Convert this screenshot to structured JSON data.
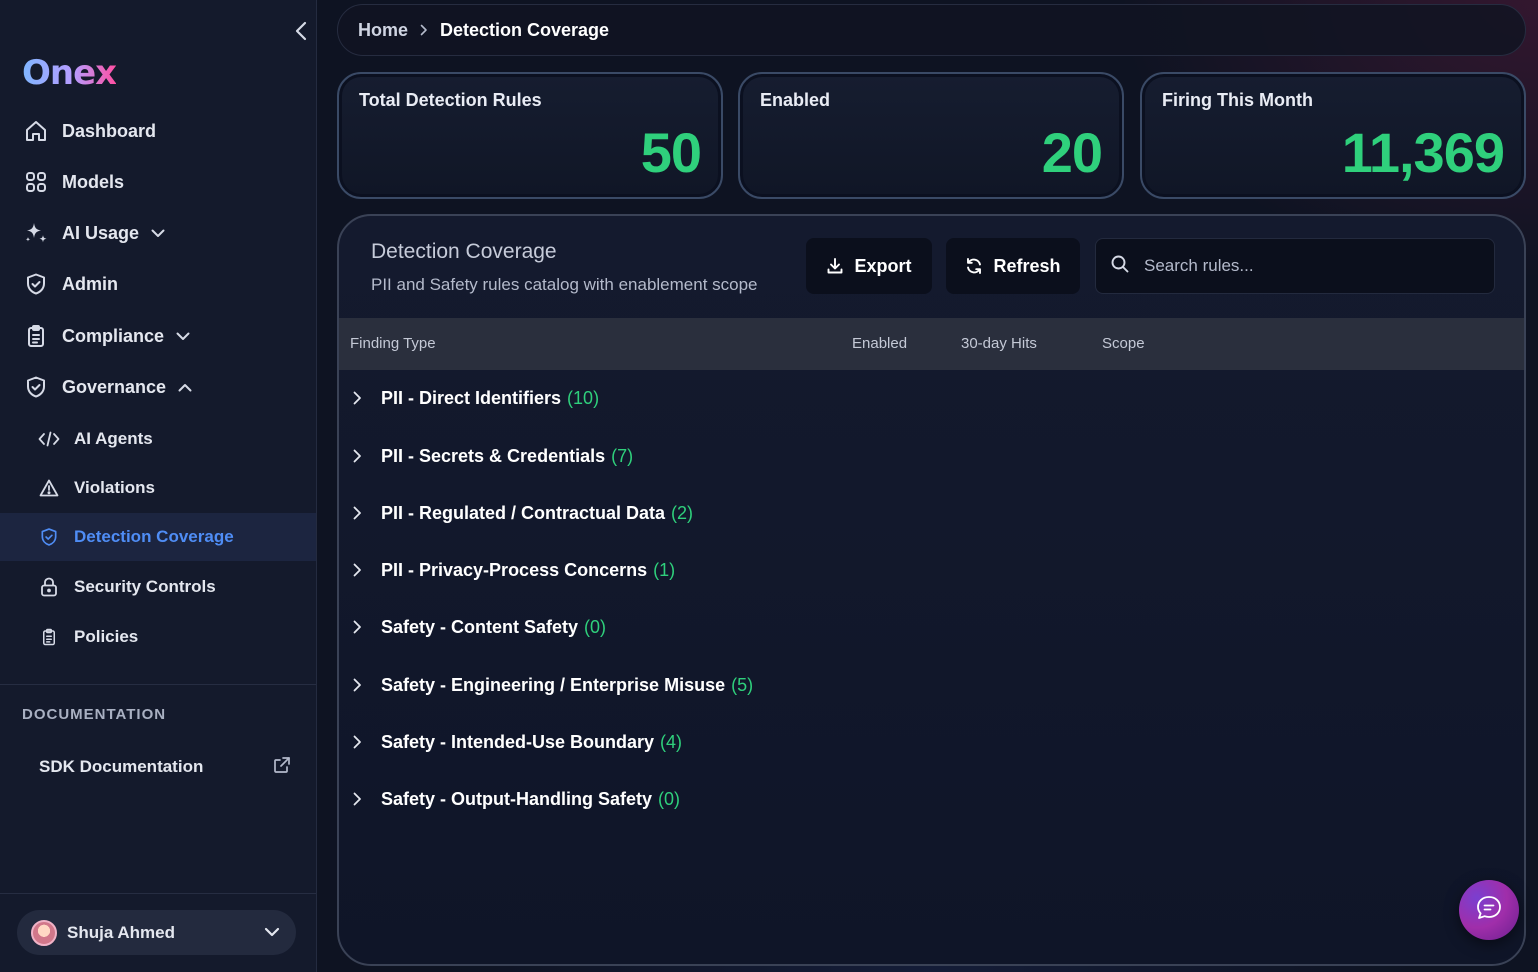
{
  "brand": {
    "logo_text": "Onex"
  },
  "sidebar": {
    "nav": [
      {
        "label": "Dashboard",
        "icon": "home-icon"
      },
      {
        "label": "Models",
        "icon": "grid-icon"
      },
      {
        "label": "AI Usage",
        "icon": "sparkles-icon",
        "expanded": false
      },
      {
        "label": "Admin",
        "icon": "shield-icon"
      },
      {
        "label": "Compliance",
        "icon": "clipboard-icon",
        "expanded": false
      },
      {
        "label": "Governance",
        "icon": "shield-check-icon",
        "expanded": true
      }
    ],
    "governance_items": [
      {
        "label": "AI Agents",
        "icon": "code-icon"
      },
      {
        "label": "Violations",
        "icon": "warning-icon"
      },
      {
        "label": "Detection Coverage",
        "icon": "shield-check-icon",
        "active": true
      },
      {
        "label": "Security Controls",
        "icon": "lock-icon"
      },
      {
        "label": "Policies",
        "icon": "clipboard-icon"
      }
    ],
    "documentation_header": "DOCUMENTATION",
    "sdk_link": "SDK Documentation",
    "user_name": "Shuja Ahmed"
  },
  "breadcrumb": {
    "home": "Home",
    "current": "Detection Coverage"
  },
  "stats": [
    {
      "label": "Total Detection Rules",
      "value": "50"
    },
    {
      "label": "Enabled",
      "value": "20"
    },
    {
      "label": "Firing This Month",
      "value": "11,369"
    }
  ],
  "panel": {
    "title": "Detection Coverage",
    "subtitle": "PII and Safety rules catalog with enablement scope",
    "export_label": "Export",
    "refresh_label": "Refresh",
    "search_placeholder": "Search rules..."
  },
  "table": {
    "columns": [
      "Finding Type",
      "Enabled",
      "30-day Hits",
      "Scope"
    ],
    "groups": [
      {
        "name": "PII - Direct Identifiers",
        "count": "(10)"
      },
      {
        "name": "PII - Secrets & Credentials",
        "count": "(7)"
      },
      {
        "name": "PII - Regulated / Contractual Data",
        "count": "(2)"
      },
      {
        "name": "PII - Privacy-Process Concerns",
        "count": "(1)"
      },
      {
        "name": "Safety - Content Safety",
        "count": "(0)"
      },
      {
        "name": "Safety - Engineering / Enterprise Misuse",
        "count": "(5)"
      },
      {
        "name": "Safety - Intended-Use Boundary",
        "count": "(4)"
      },
      {
        "name": "Safety - Output-Handling Safety",
        "count": "(0)"
      }
    ]
  },
  "colors": {
    "accent_green": "#2fd07c",
    "active_blue": "#4f8df5",
    "background": "#0e1322"
  }
}
